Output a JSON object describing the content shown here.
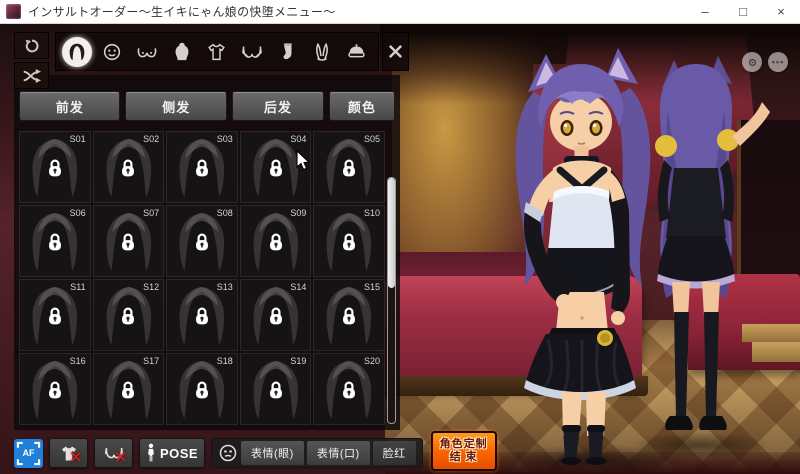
{
  "window": {
    "title": "インサルトオーダー～生イキにゃん娘の快堕メニュー～",
    "minimize": "–",
    "maximize": "□",
    "close": "×"
  },
  "side_tools": {
    "items": [
      {
        "id": "reset",
        "icon": "rotate-reset-icon"
      },
      {
        "id": "random",
        "icon": "shuffle-icon"
      }
    ]
  },
  "category_bar": {
    "selected_id": "hair",
    "items": [
      {
        "id": "hair",
        "icon": "wig-icon"
      },
      {
        "id": "face",
        "icon": "face-icon"
      },
      {
        "id": "chest",
        "icon": "chest-icon"
      },
      {
        "id": "body",
        "icon": "dress-icon"
      },
      {
        "id": "tops",
        "icon": "shirt-icon"
      },
      {
        "id": "underwear",
        "icon": "bra-icon"
      },
      {
        "id": "legwear",
        "icon": "stocking-icon"
      },
      {
        "id": "accessory",
        "icon": "bunny-ears-icon"
      },
      {
        "id": "headwear",
        "icon": "beret-icon"
      }
    ],
    "close_icon": "x-icon"
  },
  "hair_panel": {
    "tabs": [
      {
        "label": "前发",
        "active": true
      },
      {
        "label": "侧发",
        "active": false
      },
      {
        "label": "后发",
        "active": false
      },
      {
        "label": "颜色",
        "active": false
      }
    ],
    "items": [
      {
        "id": "S01",
        "locked": true
      },
      {
        "id": "S02",
        "locked": true
      },
      {
        "id": "S03",
        "locked": true
      },
      {
        "id": "S04",
        "locked": true
      },
      {
        "id": "S05",
        "locked": true
      },
      {
        "id": "S06",
        "locked": true
      },
      {
        "id": "S07",
        "locked": true
      },
      {
        "id": "S08",
        "locked": true
      },
      {
        "id": "S09",
        "locked": true
      },
      {
        "id": "S10",
        "locked": true
      },
      {
        "id": "S11",
        "locked": true
      },
      {
        "id": "S12",
        "locked": true
      },
      {
        "id": "S13",
        "locked": true
      },
      {
        "id": "S14",
        "locked": true
      },
      {
        "id": "S15",
        "locked": true
      },
      {
        "id": "S16",
        "locked": true
      },
      {
        "id": "S17",
        "locked": true
      },
      {
        "id": "S18",
        "locked": true
      },
      {
        "id": "S19",
        "locked": true
      },
      {
        "id": "S20",
        "locked": true
      }
    ],
    "scrollbar": {
      "thumb_top_pct": 0,
      "thumb_height_pct": 45
    }
  },
  "bottom_bar": {
    "af": "AF",
    "pose": "POSE",
    "expressions": {
      "eyes": "表情(眼)",
      "mouth": "表情(口)",
      "blush": "脸红"
    },
    "finish": {
      "line1": "角色定制",
      "line2": "结 束"
    }
  },
  "viewport_overlay": {
    "more": "•••"
  },
  "colors": {
    "accent_orange": "#ff6a00",
    "af_blue": "#1f7fd9",
    "panel_bg": "rgba(14,10,10,0.84)",
    "lock_white": "#ffffff",
    "hair_purple": "#6f5fae",
    "bed_red": "#9e2e44",
    "floor_tan": "#cfa766"
  }
}
